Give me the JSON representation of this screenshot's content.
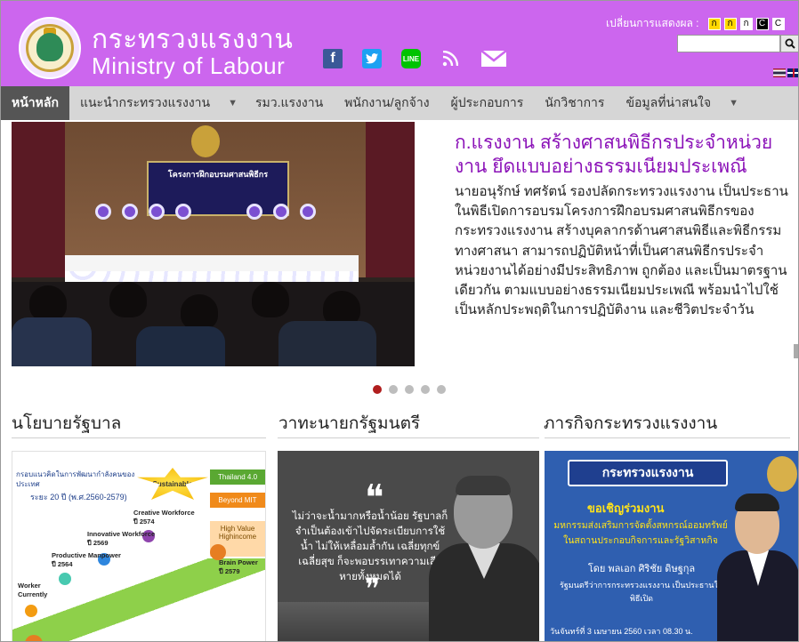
{
  "header": {
    "site_name_th": "กระทรวงแรงงาน",
    "site_name_en": "Ministry of Labour",
    "display_mode_label": "เปลี่ยนการแสดงผล :",
    "display_modes": [
      "ก",
      "ก",
      "ก",
      "C",
      "C"
    ],
    "search_placeholder": "",
    "search_icon": "search-icon",
    "social": [
      "facebook-icon",
      "twitter-icon",
      "line-icon",
      "rss-icon",
      "mail-icon"
    ],
    "languages": [
      "th-flag-icon",
      "en-flag-icon"
    ]
  },
  "colors": {
    "header_bg": "#cc66ee",
    "nav_bg": "#d6d6d6",
    "nav_active_bg": "#555555",
    "headline": "#8b12b8",
    "dot_active": "#b01e1e"
  },
  "nav": {
    "items": [
      "หน้าหลัก",
      "แนะนำกระทรวงแรงงาน",
      "รมว.แรงงาน",
      "พนักงาน/ลูกจ้าง",
      "ผู้ประกอบการ",
      "นักวิชาการ",
      "ข้อมูลที่น่าสนใจ"
    ],
    "caret": "▼"
  },
  "hero": {
    "photo_banner": "โครงการฝึกอบรมศาสนพิธีกร",
    "title": "ก.แรงงาน สร้างศาสนพิธีกรประจำหน่วยงาน ยึดแบบอย่างธรรมเนียมประเพณี",
    "text": "นายอนุรักษ์ ทศรัตน์ รองปลัดกระทรวงแรงงาน เป็นประธานในพิธีเปิดการอบรมโครงการฝึกอบรมศาสนพิธีกรของกระทรวงแรงงาน สร้างบุคลากรด้านศาสนพิธีและพิธีกรรมทางศาสนา สามารถปฏิบัติหน้าที่เป็นศาสนพิธีกรประจำหน่วยงานได้อย่างมีประสิทธิภาพ ถูกต้อง และเป็นมาตรฐานเดียวกัน ตามแบบอย่างธรรมเนียมประเพณี พร้อมนำไปใช้เป็นหลักประพฤติในการปฏิบัติงาน และชีวิตประจำวัน",
    "slide_count": 5,
    "active_slide": 1
  },
  "sections": {
    "policy_title": "นโยบายรัฐบาล",
    "speech_title": "วาทะนายกรัฐมนตรี",
    "mission_title": "ภารกิจกระทรวงแรงงาน"
  },
  "policy_card": {
    "heading": "กรอบแนวคิดในการพัฒนากำลังคนของประเทศ",
    "period": "ระยะ 20 ปี (พ.ศ.2560-2579)",
    "sustainable": "Sustainable",
    "thailand40": "Thailand 4.0",
    "beyond_mit": "Beyond MIT",
    "high_value": "High Value Highincome",
    "stages": [
      {
        "label": "Creative Workforce",
        "year": "ปี 2574"
      },
      {
        "label": "Innovative Workforce",
        "year": "ปี 2569"
      },
      {
        "label": "Productive Manpower",
        "year": "ปี 2564"
      },
      {
        "label": "Worker Currently",
        "year": ""
      },
      {
        "label": "Brain Power",
        "year": "ปี 2579"
      }
    ]
  },
  "speech_card": {
    "quote_open": "❝",
    "quote": "ไม่ว่าจะน้ำมากหรือน้ำน้อย รัฐบาลก็จำเป็นต้องเข้าไปจัดระเบียบการใช้น้ำ ไม่ให้เหลื่อมล้ำกัน เฉลี่ยทุกข์เฉลี่ยสุข ก็จะพอบรรเทาความเสียหายทั้งหมดได้",
    "quote_close": "❞"
  },
  "mission_card": {
    "banner": "กระทรวงแรงงาน",
    "invite": "ขอเชิญร่วมงาน",
    "desc": "มหกรรมส่งเสริมการจัดตั้งสหกรณ์ออมทรัพย์ ในสถานประกอบกิจการและรัฐวิสาหกิจ",
    "by": "โดย พลเอก ศิริชัย ดิษฐกุล",
    "role": "รัฐมนตรีว่าการกระทรวงแรงงาน เป็นประธานในพิธีเปิด",
    "date": "วันจันทร์ที่ 3 เมษายน 2560 เวลา 08.30 น."
  }
}
